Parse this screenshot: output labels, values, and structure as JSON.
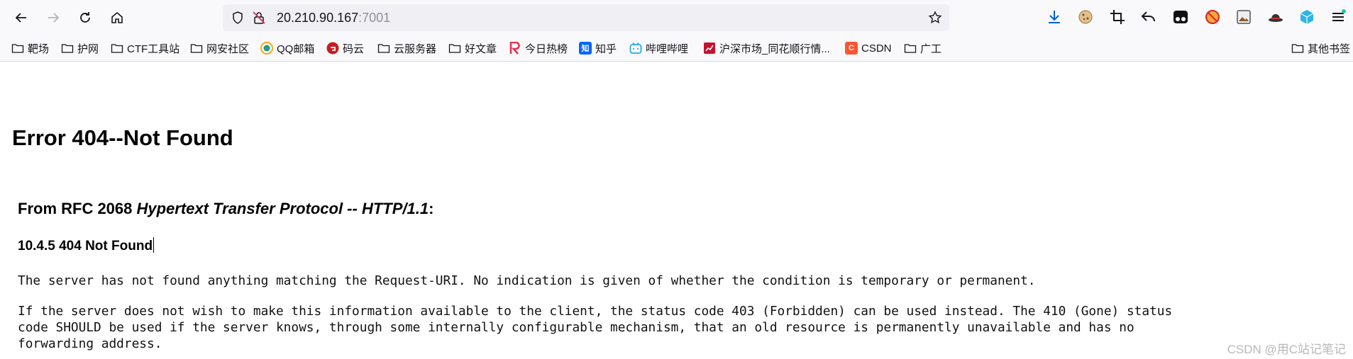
{
  "browser": {
    "url": {
      "host": "20.210.90.167",
      "port": ":7001"
    },
    "bookmarks": [
      {
        "label": "靶场",
        "icon": "folder-icon"
      },
      {
        "label": "护网",
        "icon": "folder-icon"
      },
      {
        "label": "CTF工具站",
        "icon": "folder-icon"
      },
      {
        "label": "网安社区",
        "icon": "folder-icon"
      },
      {
        "label": "QQ邮箱",
        "icon": "qqmail-icon"
      },
      {
        "label": "码云",
        "icon": "gitee-icon"
      },
      {
        "label": "云服务器",
        "icon": "folder-icon"
      },
      {
        "label": "好文章",
        "icon": "folder-icon"
      },
      {
        "label": "今日热榜",
        "icon": "tophub-icon"
      },
      {
        "label": "知乎",
        "icon": "zhihu-icon",
        "badge": "知"
      },
      {
        "label": "哔哩哔哩",
        "icon": "bilibili-icon"
      },
      {
        "label": "沪深市场_同花顺行情...",
        "icon": "ths-icon"
      },
      {
        "label": "CSDN",
        "icon": "csdn-icon",
        "badge": "C"
      },
      {
        "label": "广工",
        "icon": "folder-icon"
      }
    ],
    "other_bookmarks": "其他书签",
    "colors": {
      "gitee": "#c71d23",
      "tophub": "#e8344e",
      "zhihu": "#0066ff",
      "bilibili": "#23ade5",
      "csdn": "#fc5531",
      "download": "#0060df"
    }
  },
  "page": {
    "title": "Error 404--Not Found",
    "rfc_prefix": "From RFC 2068 ",
    "rfc_title": "Hypertext Transfer Protocol -- HTTP/1.1",
    "rfc_suffix": ":",
    "section": "10.4.5 404 Not Found",
    "para1": "The server has not found anything matching the Request-URI. No indication is given of whether the condition is temporary or permanent.",
    "para2_line1": "If the server does not wish to make this information available to the client, the status code 403 (Forbidden) can be used instead. The 410 (Gone) status",
    "para2_line2": "code SHOULD be used if the server knows, through some internally configurable mechanism, that an old resource is permanently unavailable and has no",
    "para2_line3": "forwarding address."
  },
  "watermark": "CSDN @用C站记笔记"
}
